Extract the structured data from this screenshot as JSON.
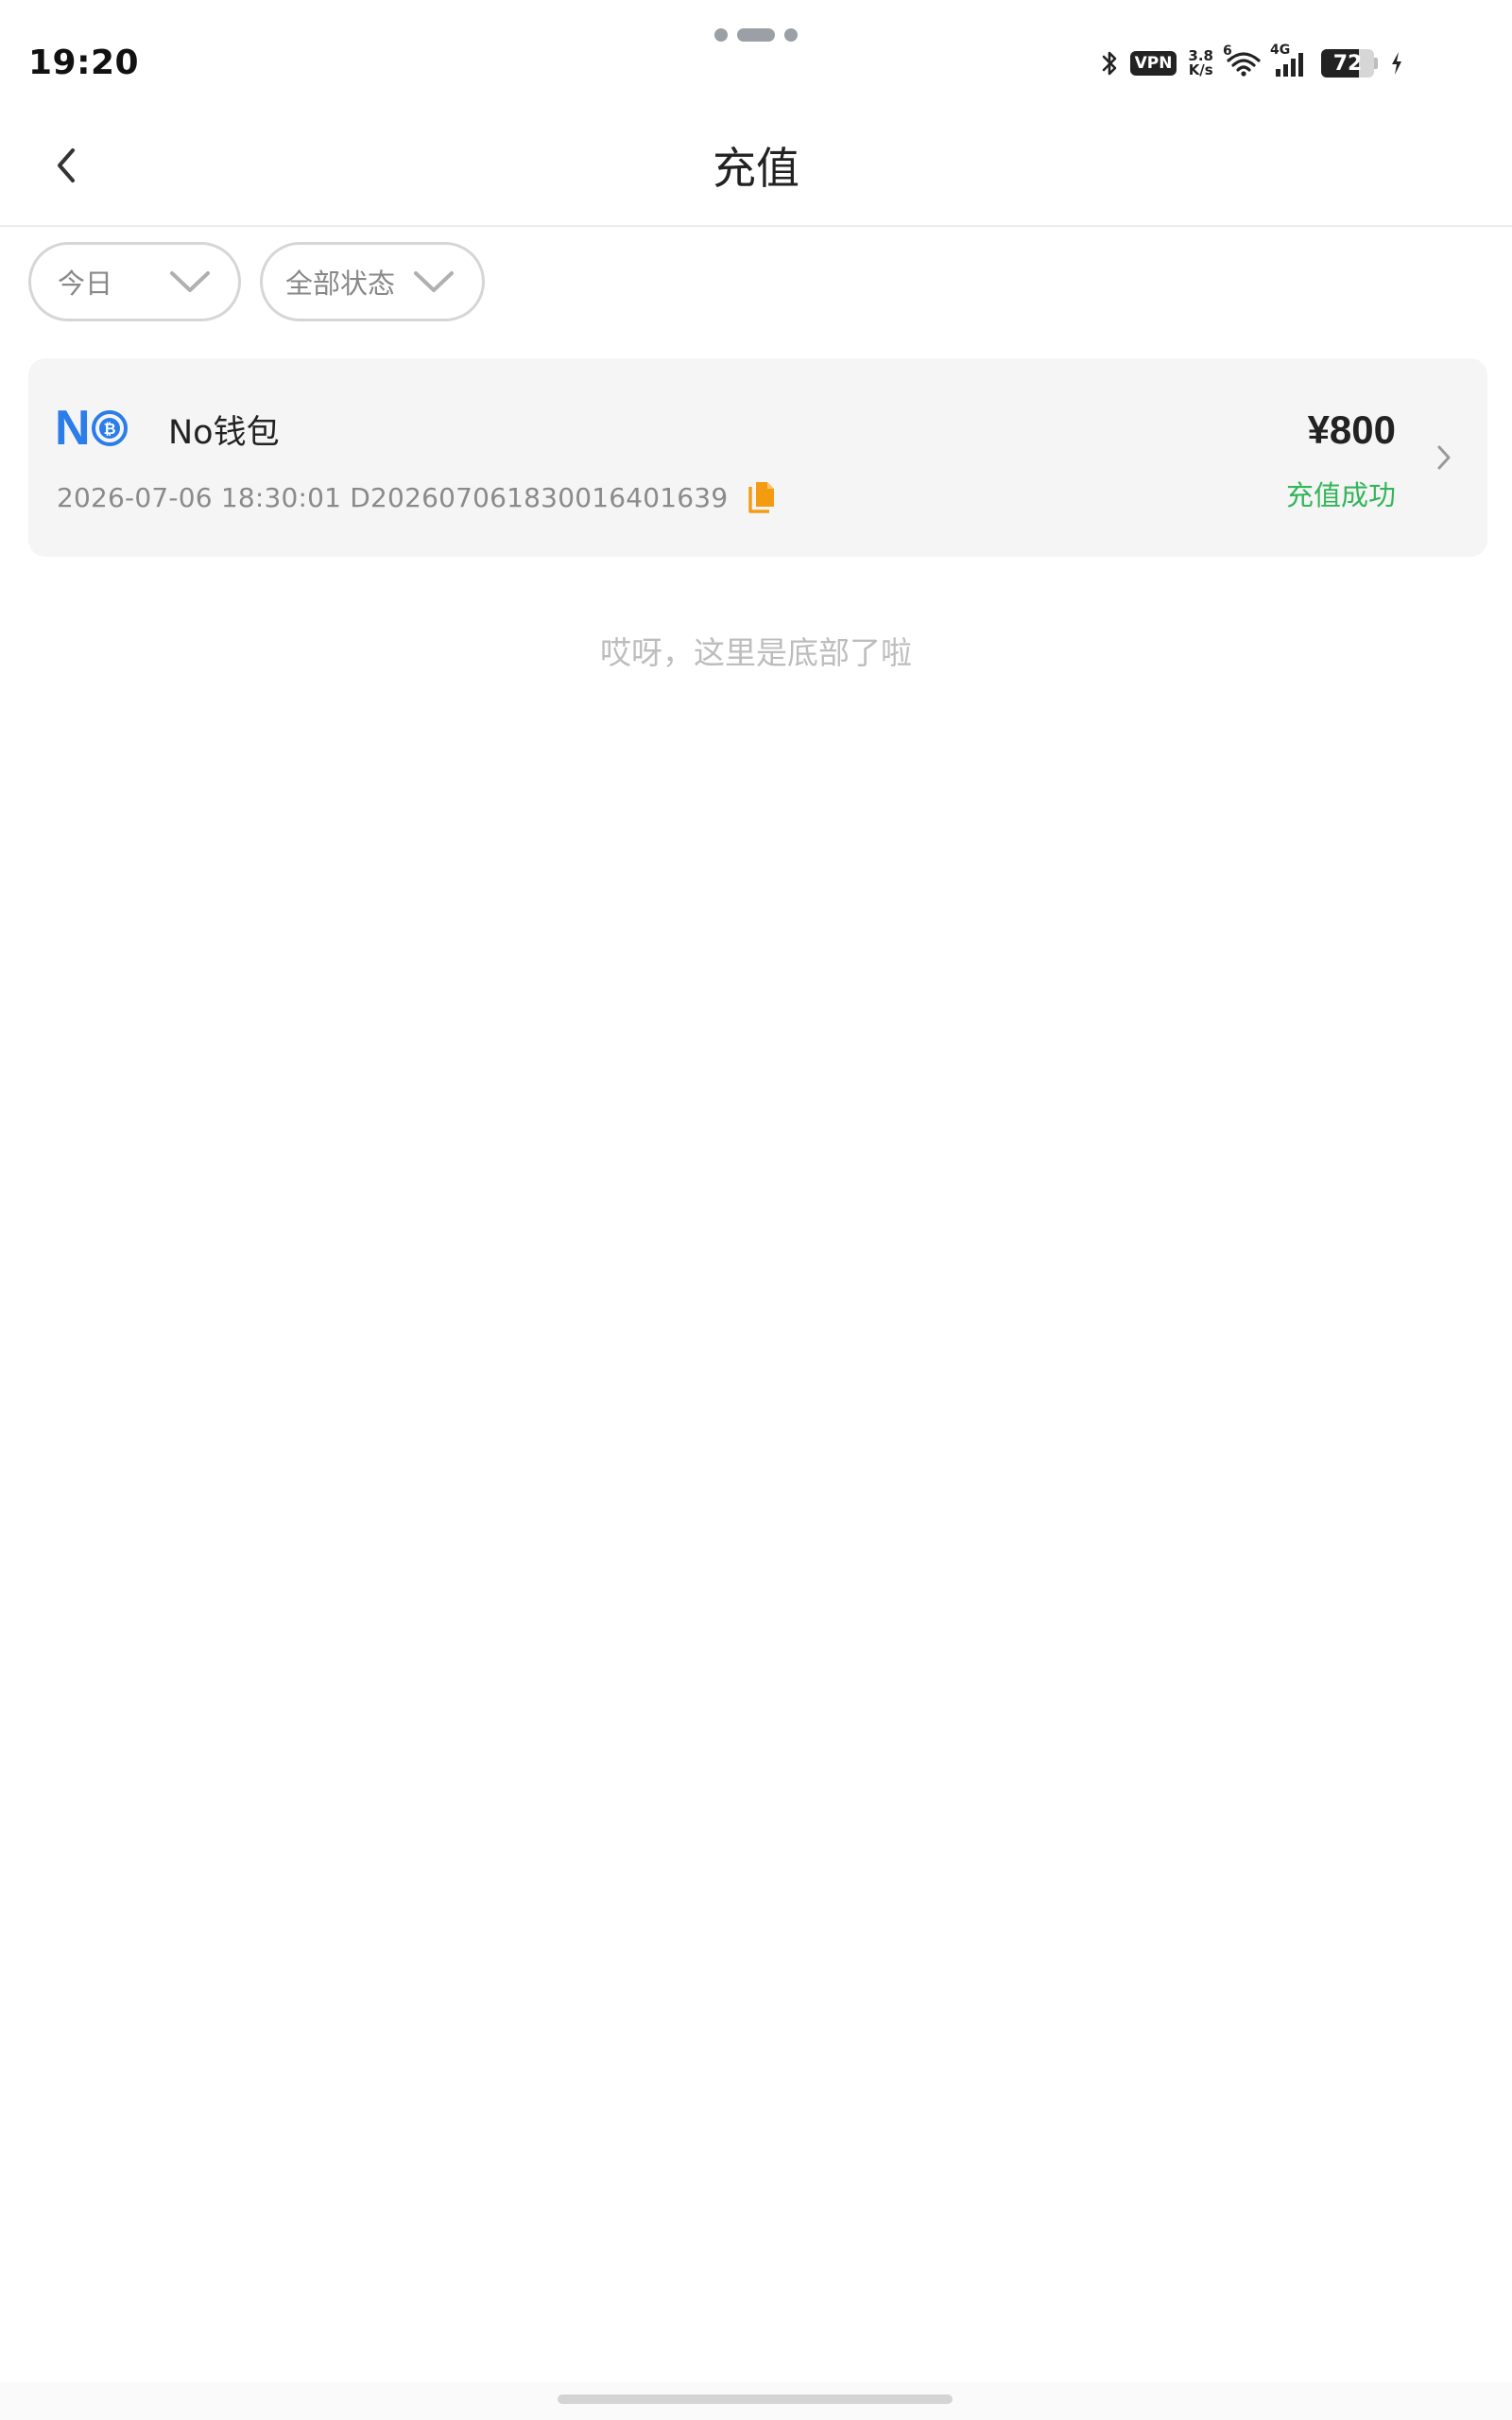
{
  "status_bar": {
    "time": "19:20",
    "vpn": "VPN",
    "speed_value": "3.8",
    "speed_unit": "K/s",
    "wifi_tag": "6",
    "network": "4G",
    "battery": "72",
    "battery_level": 0.72
  },
  "nav": {
    "title": "充值",
    "back_icon": "chevron-left-icon"
  },
  "filters": {
    "date": {
      "label": "今日",
      "icon": "chevron-down-icon"
    },
    "status": {
      "label": "全部状态",
      "icon": "chevron-down-icon"
    }
  },
  "records": [
    {
      "logo_text": "N",
      "logo_coin_icon": "bitcoin-icon",
      "wallet_name": "No钱包",
      "datetime": "2026-07-06 18:30:01",
      "order_id": "D20260706183001640163 9",
      "meta_line": "2026-07-06 18:30:01 D202607061830016401639",
      "amount": "¥800",
      "status": "充值成功",
      "status_color": "#34b55a",
      "copy_icon": "copy-icon",
      "chevron_icon": "chevron-right-icon"
    }
  ],
  "end_note": "哎呀，这里是底部了啦",
  "colors": {
    "accent_blue": "#2b7de9",
    "copy_orange": "#f39c12",
    "success_green": "#34b55a"
  }
}
